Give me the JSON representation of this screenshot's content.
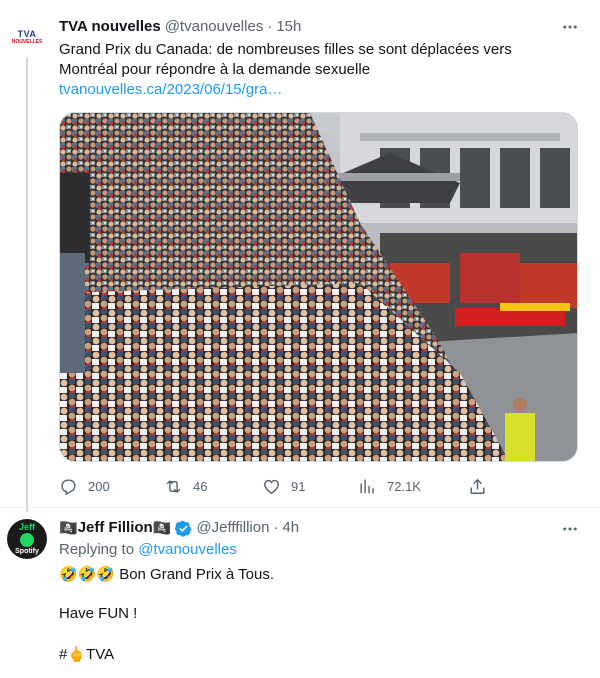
{
  "tweet1": {
    "avatar": {
      "logo_text": "TVA",
      "logo_sub": "NOUVELLES"
    },
    "name": "TVA nouvelles",
    "handle": "@tvanouvelles",
    "separator": "·",
    "time": "15h",
    "text_line1": "Grand Prix du Canada: de nombreuses filles se sont déplacées vers",
    "text_line2": "Montréal pour répondre à la demande sexuelle",
    "link": "tvanouvelles.ca/2023/06/15/gra…",
    "more_icon": "more-horizontal-icon",
    "actions": {
      "replies": "200",
      "retweets": "46",
      "likes": "91",
      "views": "72.1K"
    }
  },
  "tweet2": {
    "avatar": {
      "line1": "Jeff",
      "line3": "Spotify"
    },
    "name_prefix_emoji": "🏴‍☠️",
    "name": "Jeff Fillion",
    "name_suffix_emoji": "🏴‍☠️",
    "handle": "@Jefffillion",
    "separator": "·",
    "time": "4h",
    "replying_label": "Replying to ",
    "replying_to": "@tvanouvelles",
    "line1_emoji": "🤣🤣🤣",
    "line1_text": " Bon Grand Prix à Tous.",
    "line2": "Have FUN !",
    "line3_prefix": "#",
    "line3_emoji": "🖕",
    "line3_text": "TVA"
  },
  "colors": {
    "accent": "#1d9bf0",
    "secondary_text": "#536471",
    "primary_text": "#0f1419",
    "border": "#eff3f4"
  }
}
